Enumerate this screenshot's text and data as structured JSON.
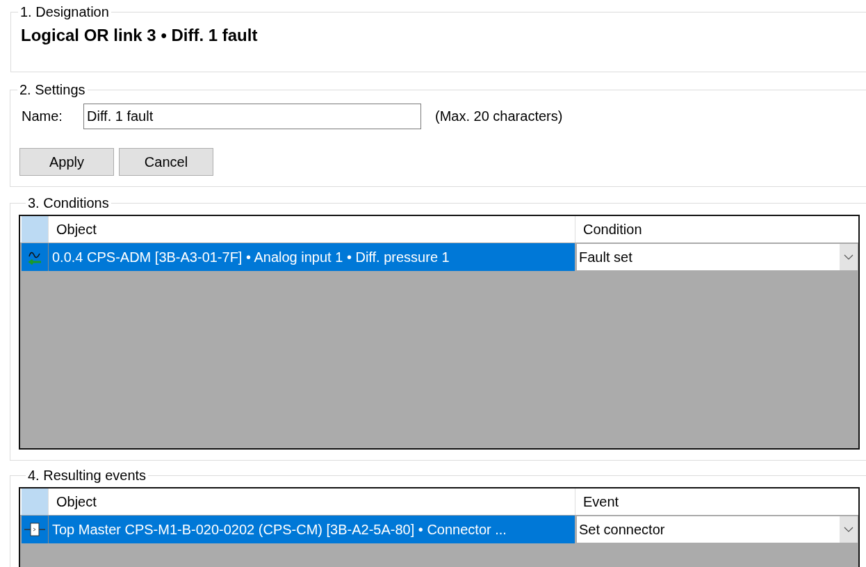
{
  "designation": {
    "legend": "1. Designation",
    "title": "Logical OR link 3 • Diff. 1 fault"
  },
  "settings": {
    "legend": "2. Settings",
    "name_label": "Name:",
    "name_value": "Diff. 1 fault",
    "hint": "(Max. 20 characters)",
    "buttons": [
      "Apply",
      "Cancel"
    ]
  },
  "conditions": {
    "legend": "3. Conditions",
    "columns": [
      "Object",
      "Condition"
    ],
    "rows": [
      {
        "kind": "analog",
        "object": "0.0.4 CPS-ADM [3B-A3-01-7F] • Analog input 1 • Diff. pressure 1",
        "value": "Fault set",
        "selected": true
      }
    ]
  },
  "events": {
    "legend": "4. Resulting events",
    "columns": [
      "Object",
      "Event"
    ],
    "rows": [
      {
        "kind": "connector",
        "object": "Top Master CPS-M1-B-020-0202 (CPS-CM) [3B-A2-5A-80] • Connector ...",
        "value": "Set connector",
        "selected": true
      }
    ]
  }
}
